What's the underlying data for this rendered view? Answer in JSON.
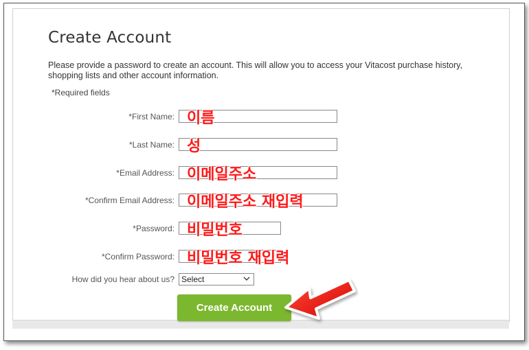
{
  "page": {
    "title": "Create Account",
    "intro": "Please provide a password to create an account. This will allow you to access your Vitacost purchase history, shopping lists and other account information.",
    "required_note": "*Required fields"
  },
  "form": {
    "first_name": {
      "label": "*First Name:",
      "annotation": "이름"
    },
    "last_name": {
      "label": "*Last Name:",
      "annotation": "성"
    },
    "email": {
      "label": "*Email Address:",
      "annotation": "이메일주소"
    },
    "confirm_email": {
      "label": "*Confirm Email Address:",
      "annotation": "이메일주소 재입력"
    },
    "password": {
      "label": "*Password:",
      "annotation": "비밀번호"
    },
    "confirm_password": {
      "label": "*Confirm Password:",
      "annotation": "비밀번호 재입력"
    },
    "hear_about": {
      "label": "How did you hear about us?",
      "selected": "Select"
    },
    "submit_label": "Create Account"
  },
  "colors": {
    "button": "#7cb82f",
    "annotation": "#ff1a1a",
    "arrow": "#ee1111"
  },
  "icons": [
    "chevron-down-icon",
    "red-arrow-icon"
  ]
}
